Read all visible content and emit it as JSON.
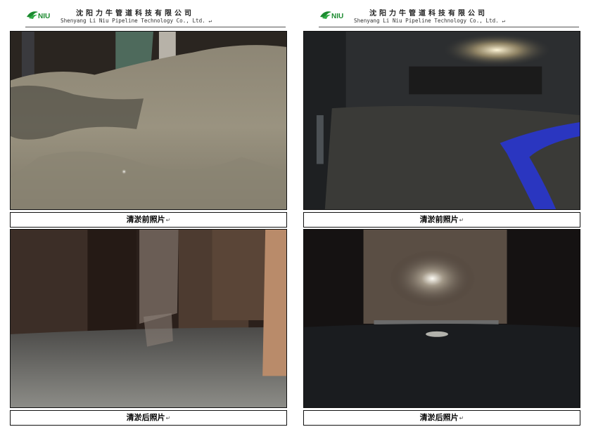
{
  "header": {
    "company_cn": "沈阳力牛管道科技有限公司",
    "company_en": "Shenyang Li Niu Pipeline Technology Co., Ltd.",
    "logo_text": "NIU",
    "para_mark": "↵"
  },
  "pages": [
    {
      "top_caption": "清淤前照片",
      "bottom_caption": "清淤后照片"
    },
    {
      "top_caption": "清淤前照片",
      "bottom_caption": "清淤后照片"
    }
  ],
  "colors": {
    "logo_green": "#1a8a2e",
    "frame": "#111111"
  }
}
